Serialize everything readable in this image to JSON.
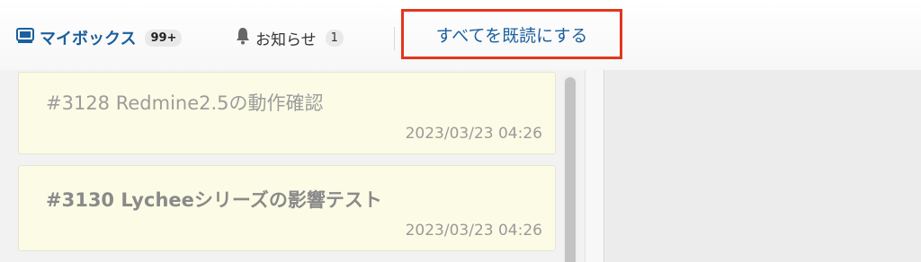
{
  "header": {
    "mybox": {
      "icon": "inbox-icon",
      "label": "マイボックス",
      "count": "99+"
    },
    "notice": {
      "icon": "bell-icon",
      "label": "お知らせ",
      "count": "1"
    },
    "mark_all_read_label": "すべてを既読にする"
  },
  "list": {
    "items": [
      {
        "title": "#3128 Redmine2.5の動作確認",
        "time": "2023/03/23 04:26"
      },
      {
        "title": "#3130 Lycheeシリーズの影響テスト",
        "time": "2023/03/23 04:26"
      }
    ]
  },
  "colors": {
    "accent": "#1b5f9e",
    "highlight_border": "#e2361d",
    "item_bg": "#fcfce6"
  }
}
